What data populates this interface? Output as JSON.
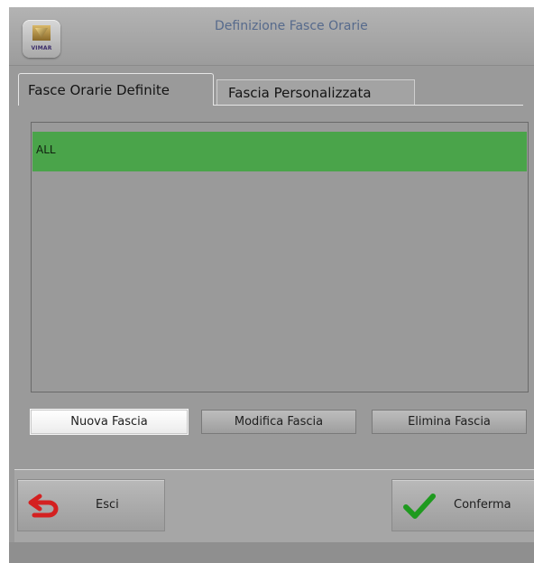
{
  "window": {
    "title": "Definizione Fasce Orarie",
    "logo_text": "VIMAR"
  },
  "tabs": [
    {
      "label": "Fasce Orarie Definite",
      "active": true
    },
    {
      "label": "Fascia Personalizzata",
      "active": false
    }
  ],
  "list": {
    "items": [
      {
        "label": "ALL",
        "selected": true
      }
    ]
  },
  "actions": {
    "new_label": "Nuova Fascia",
    "edit_label": "Modifica Fascia",
    "delete_label": "Elimina Fascia"
  },
  "footer": {
    "exit_label": "Esci",
    "exit_icon": "undo-arrow-icon",
    "confirm_label": "Conferma",
    "confirm_icon": "checkmark-icon"
  },
  "colors": {
    "selected_row": "#4aa44a",
    "exit_icon": "#d42020",
    "confirm_icon": "#1f9a1f",
    "title_text": "#566a8c"
  }
}
